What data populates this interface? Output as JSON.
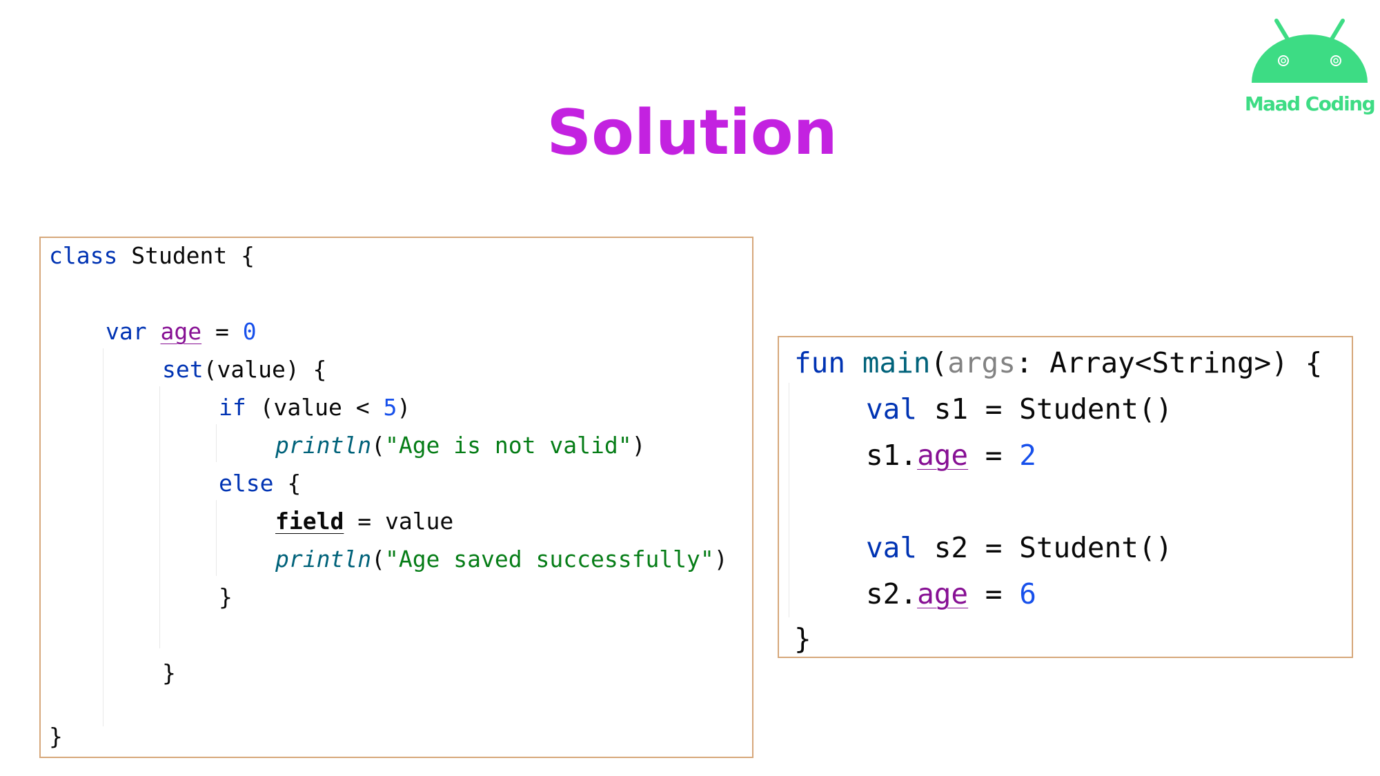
{
  "title": "Solution",
  "colors": {
    "title": "#c322e0",
    "logo": "#3ddc84",
    "panel_border": "#d6a77a",
    "keyword": "#0033b3",
    "property": "#871094",
    "number": "#1750eb",
    "string": "#067d17",
    "function": "#00627a"
  },
  "logo": {
    "text": "Maad Coding",
    "icon": "android-robot-icon"
  },
  "student_class": {
    "l1_kw": "class",
    "l1_rest": " Student {",
    "l2_kw": "var",
    "l2_prop": "age",
    "l2_eq": " = ",
    "l2_num": "0",
    "l3_kw": "set",
    "l3_rest": "(value) {",
    "l4_kw": "if",
    "l4_rest": " (value < ",
    "l4_num": "5",
    "l4_close": ")",
    "l5_fn": "println",
    "l5_open": "(",
    "l5_str": "\"Age is not valid\"",
    "l5_close": ")",
    "l6_kw": "else",
    "l6_rest": " {",
    "l7_field": "field",
    "l7_rest": " = value",
    "l8_fn": "println",
    "l8_open": "(",
    "l8_str": "\"Age saved successfully\"",
    "l8_close": ")",
    "l9": "}",
    "l10": "}",
    "l11": "}"
  },
  "main_fun": {
    "l1_kw": "fun",
    "l1_name": "main",
    "l1_open": "(",
    "l1_param": "args",
    "l1_rest": ": Array<String>) {",
    "l2_kw": "val",
    "l2_rest": " s1 = Student()",
    "l3_var": "s1.",
    "l3_prop": "age",
    "l3_eq": " = ",
    "l3_num": "2",
    "l4_kw": "val",
    "l4_rest": " s2 = Student()",
    "l5_var": "s2.",
    "l5_prop": "age",
    "l5_eq": " = ",
    "l5_num": "6",
    "l6": "}"
  }
}
